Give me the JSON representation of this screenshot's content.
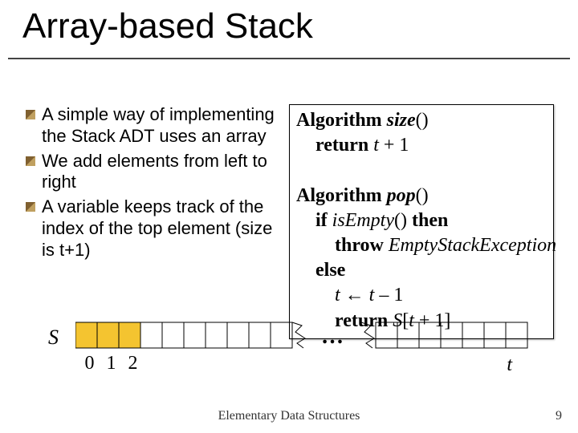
{
  "title": "Array-based Stack",
  "bullets": [
    "A simple way of implementing the Stack ADT uses an array",
    "We add elements from left to right",
    "A variable keeps track of the  index of the top element (size is t+1)"
  ],
  "algo": {
    "l1_kw": "Algorithm ",
    "l1_fn": "size",
    "l1_paren": "()",
    "l2_kw": "return ",
    "l2_var": "t",
    "l2_rest": " + 1",
    "l3_kw": "Algorithm ",
    "l3_fn": "pop",
    "l3_paren": "()",
    "l4_kw": "if ",
    "l4_fn": "isEmpty",
    "l4_paren": "() ",
    "l4_then": "then",
    "l5_kw": "throw ",
    "l5_ex": "EmptyStackException",
    "l6_kw": "else",
    "l7_var1": "t",
    "l7_arrow": " ← ",
    "l7_var2": "t",
    "l7_rest": " – 1",
    "l8_kw": "return ",
    "l8_arr": "S",
    "l8_idx_open": "[",
    "l8_var": "t",
    "l8_idx_rest": " + 1]"
  },
  "diagram": {
    "S": "S",
    "t": "t",
    "idx0": "0",
    "idx1": "1",
    "idx2": "2",
    "dots": "…"
  },
  "footer": "Elementary Data Structures",
  "page": "9"
}
